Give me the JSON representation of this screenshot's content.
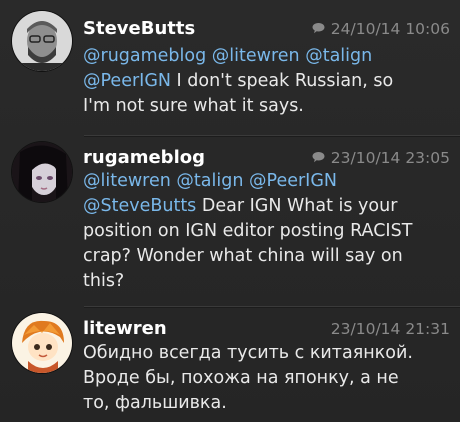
{
  "tweets": [
    {
      "username": "SteveButts",
      "timestamp": "24/10/14 10:06",
      "has_conversation_icon": true,
      "text_lines": [
        [
          {
            "t": "@rugameblog",
            "m": true
          },
          {
            "t": " ",
            "m": false
          },
          {
            "t": "@litewren",
            "m": true
          },
          {
            "t": " ",
            "m": false
          },
          {
            "t": "@talign",
            "m": true
          }
        ],
        [
          {
            "t": "@PeerIGN",
            "m": true
          },
          {
            "t": " I don't speak Russian, so",
            "m": false
          }
        ],
        [
          {
            "t": "I'm not sure what it says.",
            "m": false
          }
        ]
      ]
    },
    {
      "username": "rugameblog",
      "timestamp": "23/10/14 23:05",
      "has_conversation_icon": true,
      "text_lines": [
        [
          {
            "t": "@litewren",
            "m": true
          },
          {
            "t": " ",
            "m": false
          },
          {
            "t": "@talign",
            "m": true
          },
          {
            "t": " ",
            "m": false
          },
          {
            "t": "@PeerIGN",
            "m": true
          }
        ],
        [
          {
            "t": "@SteveButts",
            "m": true
          },
          {
            "t": " Dear IGN What is your",
            "m": false
          }
        ],
        [
          {
            "t": "position on IGN editor posting RACIST",
            "m": false
          }
        ],
        [
          {
            "t": "crap? Wonder what china will say on",
            "m": false
          }
        ],
        [
          {
            "t": "this?",
            "m": false
          }
        ]
      ]
    },
    {
      "username": "litewren",
      "timestamp": "23/10/14 21:31",
      "has_conversation_icon": false,
      "text_lines": [
        [
          {
            "t": "Обидно всегда тусить с китаянкой.",
            "m": false
          }
        ],
        [
          {
            "t": "Вроде бы, похожа на японку, а не",
            "m": false
          }
        ],
        [
          {
            "t": "то, фальшивка.",
            "m": false
          }
        ]
      ]
    }
  ],
  "colors": {
    "mention": "#7ab8ea",
    "text": "#e9e9e9",
    "meta": "#8a8a8a",
    "background": "#262626"
  },
  "icons": {
    "conversation": "speech-bubble-icon"
  }
}
